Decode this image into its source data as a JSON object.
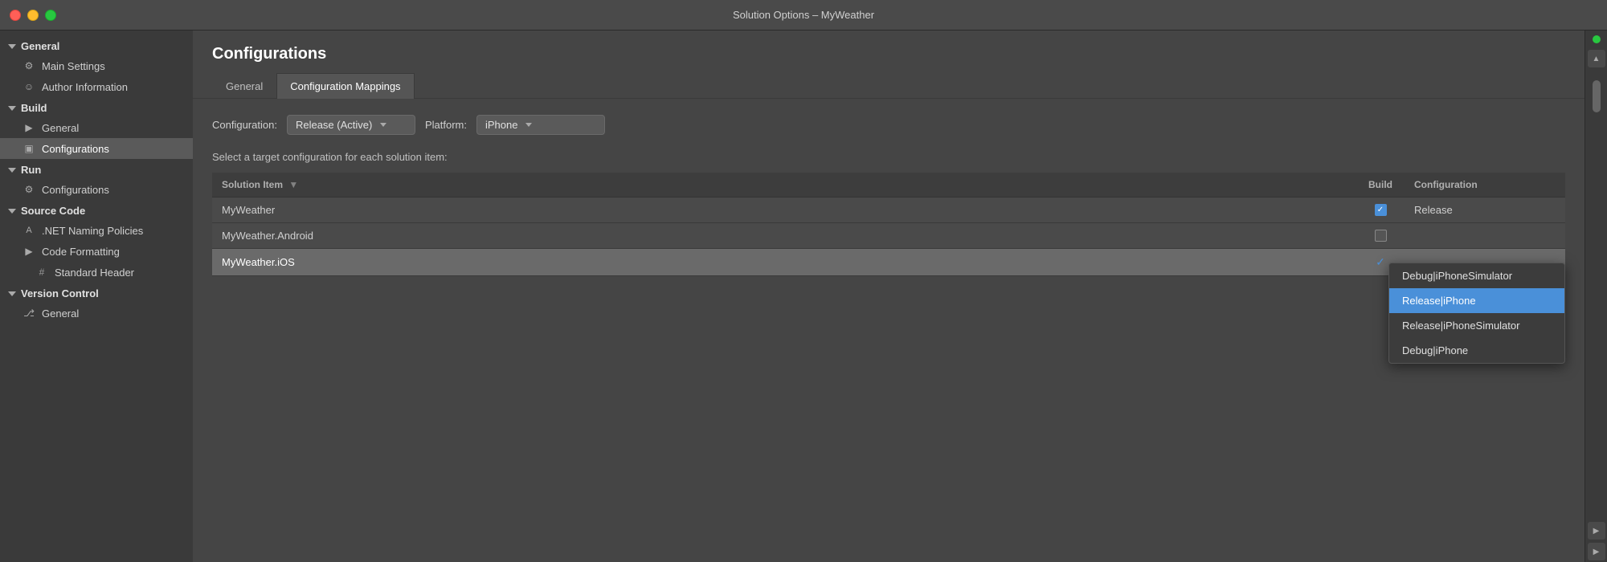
{
  "window": {
    "title": "Solution Options – MyWeather"
  },
  "sidebar": {
    "sections": [
      {
        "id": "general",
        "label": "General",
        "expanded": true,
        "items": [
          {
            "id": "main-settings",
            "label": "Main Settings",
            "icon": "⚙",
            "active": false
          },
          {
            "id": "author-info",
            "label": "Author Information",
            "icon": "☺",
            "active": false
          }
        ]
      },
      {
        "id": "build",
        "label": "Build",
        "expanded": true,
        "items": [
          {
            "id": "build-general",
            "label": "General",
            "icon": "▶",
            "active": false
          },
          {
            "id": "configurations",
            "label": "Configurations",
            "icon": "▣",
            "active": true
          }
        ]
      },
      {
        "id": "run",
        "label": "Run",
        "expanded": true,
        "items": [
          {
            "id": "run-configurations",
            "label": "Configurations",
            "icon": "⚙",
            "active": false
          }
        ]
      },
      {
        "id": "source-code",
        "label": "Source Code",
        "expanded": true,
        "items": [
          {
            "id": "naming-policies",
            "label": ".NET Naming Policies",
            "icon": "A",
            "active": false
          },
          {
            "id": "code-formatting",
            "label": "Code Formatting",
            "icon": "▶",
            "subItem": true,
            "active": false
          },
          {
            "id": "standard-header",
            "label": "Standard Header",
            "icon": "#",
            "active": false
          }
        ]
      },
      {
        "id": "version-control",
        "label": "Version Control",
        "expanded": true,
        "items": [
          {
            "id": "vc-general",
            "label": "General",
            "icon": "⎇",
            "active": false
          }
        ]
      }
    ]
  },
  "content": {
    "title": "Configurations",
    "tabs": [
      {
        "id": "general-tab",
        "label": "General",
        "active": false
      },
      {
        "id": "config-mappings-tab",
        "label": "Configuration Mappings",
        "active": true
      }
    ],
    "config_row": {
      "config_label": "Configuration:",
      "config_value": "Release (Active)",
      "platform_label": "Platform:",
      "platform_value": "iPhone"
    },
    "table": {
      "description": "Select a target configuration for each solution item:",
      "columns": [
        {
          "id": "solution-item",
          "label": "Solution Item"
        },
        {
          "id": "build",
          "label": "Build"
        },
        {
          "id": "configuration",
          "label": "Configuration"
        }
      ],
      "rows": [
        {
          "id": "myweather",
          "solution_item": "MyWeather",
          "build": true,
          "config": "Release",
          "selected": false
        },
        {
          "id": "myweather-android",
          "solution_item": "MyWeather.Android",
          "build": false,
          "config": "",
          "selected": false
        },
        {
          "id": "myweather-ios",
          "solution_item": "MyWeather.iOS",
          "build": true,
          "config": "Release|iPhone",
          "selected": true
        }
      ]
    },
    "dropdown_menu": {
      "items": [
        {
          "id": "debug-iphone-sim",
          "label": "Debug|iPhoneSimulator",
          "selected": false
        },
        {
          "id": "release-iphone",
          "label": "Release|iPhone",
          "selected": true
        },
        {
          "id": "release-iphone-sim",
          "label": "Release|iPhoneSimulator",
          "selected": false
        },
        {
          "id": "debug-iphone",
          "label": "Debug|iPhone",
          "selected": false
        }
      ]
    }
  },
  "right_panel": {
    "arrows": [
      "▲",
      "▶",
      "▶"
    ]
  }
}
